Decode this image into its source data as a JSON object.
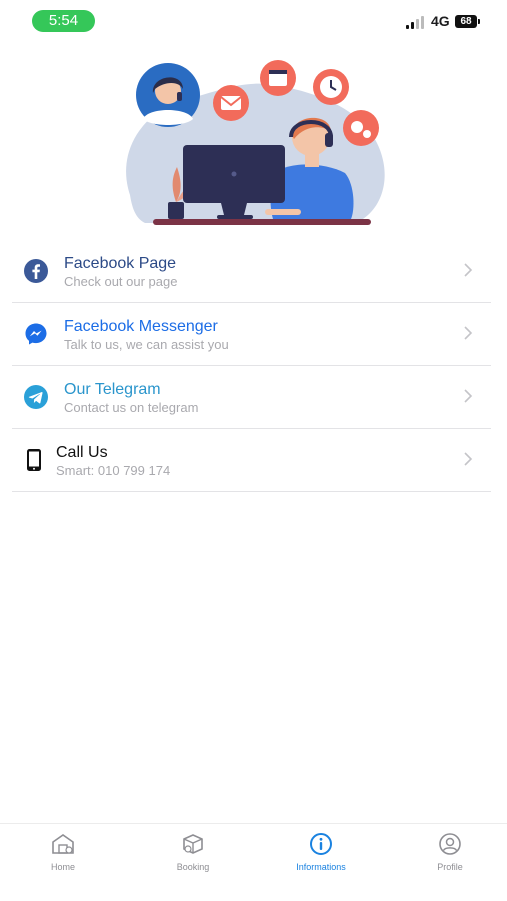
{
  "status_bar": {
    "time": "5:54",
    "network": "4G",
    "battery": "68"
  },
  "contacts": [
    {
      "title": "Facebook Page",
      "subtitle": "Check out our page",
      "icon": "facebook-icon",
      "color": "#3b5998"
    },
    {
      "title": "Facebook Messenger",
      "subtitle": "Talk to us, we can assist you",
      "icon": "messenger-icon",
      "color": "#1c6de6"
    },
    {
      "title": "Our Telegram",
      "subtitle": "Contact us on telegram",
      "icon": "telegram-icon",
      "color": "#2aa0d8"
    },
    {
      "title": "Call Us",
      "subtitle": "Smart: 010 799 174",
      "icon": "phone-icon",
      "color": "#111111"
    }
  ],
  "tab_bar": {
    "active": "informations",
    "items": [
      {
        "label": "Home",
        "icon": "home-icon"
      },
      {
        "label": "Booking",
        "icon": "box-icon"
      },
      {
        "label": "Informations",
        "icon": "info-icon"
      },
      {
        "label": "Profile",
        "icon": "profile-icon"
      }
    ]
  },
  "colors": {
    "accent": "#1a82e0",
    "status_pill": "#35c759",
    "divider": "#e3e3e6"
  }
}
